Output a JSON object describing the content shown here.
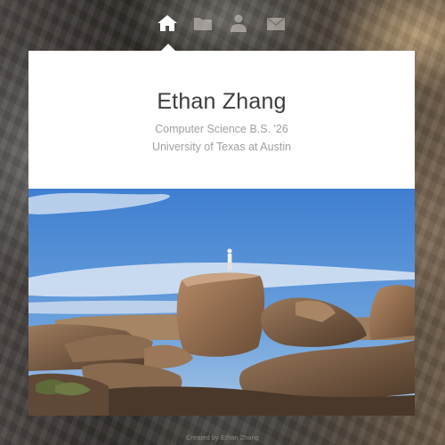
{
  "nav": {
    "items": [
      {
        "icon": "home-icon",
        "active": true
      },
      {
        "icon": "folder-icon",
        "active": false
      },
      {
        "icon": "user-icon",
        "active": false
      },
      {
        "icon": "mail-icon",
        "active": false
      }
    ]
  },
  "profile": {
    "name": "Ethan Zhang",
    "degree": "Computer Science B.S. '26",
    "school": "University of Texas at Austin"
  },
  "colors": {
    "card": "#ffffff",
    "name_text": "#3d3d3d",
    "sub_text": "#a0a0a0",
    "sky": "#3f7fd0",
    "rock": "#8a6a4e"
  },
  "footer": {
    "credit": "Created by Ethan Zhang"
  }
}
